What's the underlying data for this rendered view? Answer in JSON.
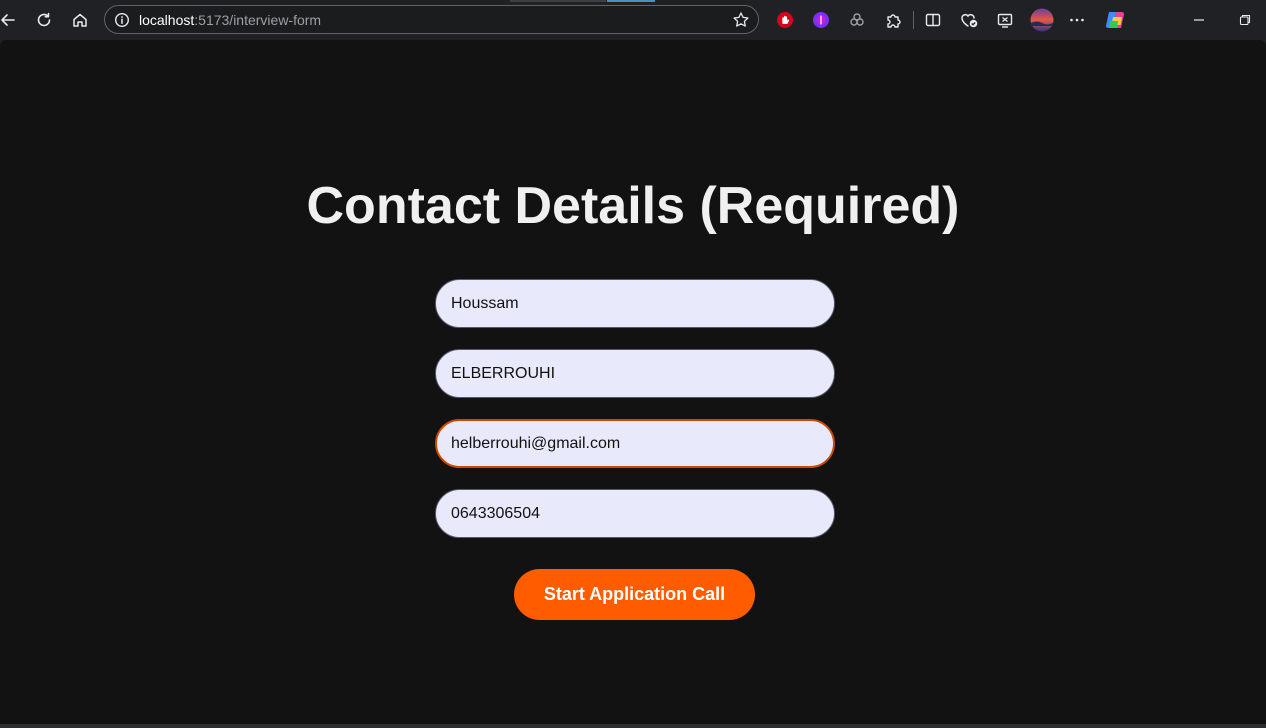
{
  "browser": {
    "url_host": "localhost",
    "url_path": ":5173/interview-form",
    "icons": {
      "back": "back-arrow-icon",
      "reload": "reload-icon",
      "home": "home-icon",
      "info": "info-icon",
      "favorite": "star-icon",
      "extensions": [
        "adblock-icon",
        "purple-extension-icon",
        "link-extension-icon",
        "puzzle-icon"
      ],
      "split_screen": "split-screen-icon",
      "favorites": "favorites-icon",
      "screenshot": "screenshot-icon",
      "profile": "profile-avatar-icon",
      "more": "more-options-icon",
      "copilot": "copilot-icon",
      "minimize": "minimize-icon",
      "restore": "restore-icon"
    }
  },
  "form": {
    "title": "Contact Details (Required)",
    "first_name": "Houssam",
    "last_name": "ELBERROUHI",
    "email": "helberrouhi@gmail.com",
    "phone": "0643306504",
    "submit_label": "Start Application Call"
  },
  "colors": {
    "page_background": "#121212",
    "accent": "#ff5c00",
    "focus_border": "#c94a00",
    "input_background": "#e8eafc"
  }
}
